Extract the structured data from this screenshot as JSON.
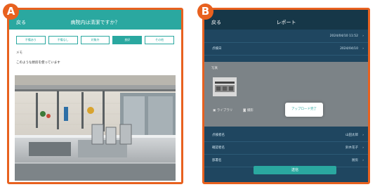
{
  "markers": {
    "a": "A",
    "b": "B"
  },
  "panel_a": {
    "nav": {
      "back": "戻る",
      "title": "病院内は清潔ですか？"
    },
    "tabs": [
      {
        "label": "不備あり",
        "selected": false
      },
      {
        "label": "不備なし",
        "selected": false
      },
      {
        "label": "対象外",
        "selected": false
      },
      {
        "label": "良好",
        "selected": true
      },
      {
        "label": "その他",
        "selected": false
      }
    ],
    "memo_label": "メモ",
    "memo_text": "このような厨房を使っています"
  },
  "panel_b": {
    "nav": {
      "back": "戻る",
      "title": "レポート"
    },
    "top_rows": [
      {
        "label": "",
        "value": "2024/04/10 11:52"
      },
      {
        "label": "点検日",
        "value": "2024/04/10"
      }
    ],
    "photo_section_label": "写真",
    "photo_actions": [
      "ライブラリ",
      "撮影"
    ],
    "toast": "アップロード完了",
    "bottom_rows": [
      {
        "label": "点検者名",
        "value": "山田太郎"
      },
      {
        "label": "確認者名",
        "value": "鈴木花子"
      },
      {
        "label": "部署名",
        "value": "厨房"
      }
    ],
    "submit_label": "送信"
  },
  "colors": {
    "accent": "#e8611f",
    "teal": "#2aa8a0",
    "navy": "#1f4660"
  }
}
